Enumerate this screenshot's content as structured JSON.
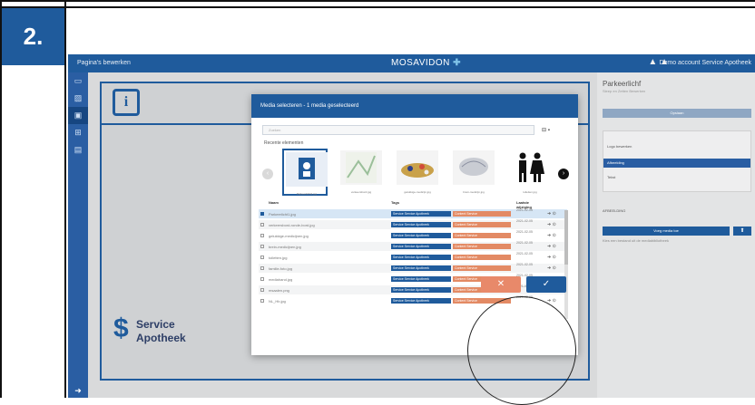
{
  "step": {
    "number": "2."
  },
  "app": {
    "title": "Pagina's bewerken",
    "logo": "MOSAVIDON",
    "account": "Demo account Service Apotheek"
  },
  "canvas": {
    "brand_line1": "Service",
    "brand_line2": "Apotheek"
  },
  "right_panel": {
    "title": "Parkeerlichf",
    "subtitle": "Sleep en Zetten Bewerken",
    "bar_label": "Opslaan",
    "items": [
      "Logo bewerken",
      "Afbeelding",
      "Tekst"
    ],
    "section": "AFBEELDING",
    "upload_button": "Voeg media toe",
    "note": "Kies een bestand uit de mediabibliotheek"
  },
  "modal": {
    "title": "Media selecteren - 1 media geselecteerd",
    "search_placeholder": "Zoeken",
    "recent_label": "Recente elementen",
    "thumbs": [
      {
        "caption": "Parkeerlicht1.jpg",
        "icon": "image-icon"
      },
      {
        "caption": "verkeersbord.jpg",
        "icon": "map-icon"
      },
      {
        "caption": "gelukkige-medicijn.jpg",
        "icon": "pills-icon"
      },
      {
        "caption": "brein-medicijn.jpg",
        "icon": "brain-icon"
      },
      {
        "caption": "toiletten.jpg",
        "icon": "toilet-icon"
      }
    ],
    "columns": {
      "name": "Naam",
      "tags": "Tags",
      "date": "Laatste wijziging"
    },
    "rows": [
      {
        "name": "Parkeerlicht1.jpg",
        "tag1": "Service Service Apotheek",
        "tag2": "Content Service",
        "date": "2021-02-05",
        "selected": true
      },
      {
        "name": "verkeersbord-ronde-bord.jpg",
        "tag1": "Service Service Apotheek",
        "tag2": "Content Service",
        "date": "2021-02-05",
        "selected": false
      },
      {
        "name": "gelukkige-medicijnen.jpg",
        "tag1": "Service Service Apotheek",
        "tag2": "Content Service",
        "date": "2021-02-05",
        "selected": false
      },
      {
        "name": "brein-medicijnen.jpg",
        "tag1": "Service Service Apotheek",
        "tag2": "Content Service",
        "date": "2021-02-05",
        "selected": false
      },
      {
        "name": "toiletten.jpg",
        "tag1": "Service Service Apotheek",
        "tag2": "Content Service",
        "date": "2021-02-05",
        "selected": false
      },
      {
        "name": "familie-foto.jpg",
        "tag1": "Service Service Apotheek",
        "tag2": "Content Service",
        "date": "2021-02-05",
        "selected": false
      },
      {
        "name": "mediahand.jpg",
        "tag1": "Service Service Apotheek",
        "tag2": "Content Service",
        "date": "2021-02-05",
        "selected": false
      },
      {
        "name": "msaalen.png",
        "tag1": "Service Service Apotheek",
        "tag2": "Content Service",
        "date": "2021-02-05",
        "selected": false
      },
      {
        "name": "NL_Hb.jpg",
        "tag1": "Service Service Apotheek",
        "tag2": "Content Service",
        "date": "2021-02-05",
        "selected": false
      }
    ],
    "cancel_symbol": "✕",
    "confirm_symbol": "✓"
  },
  "colors": {
    "primary": "#1f5b9c",
    "accent_cancel": "#e8896a",
    "step_badge": "#1f5b9c"
  }
}
